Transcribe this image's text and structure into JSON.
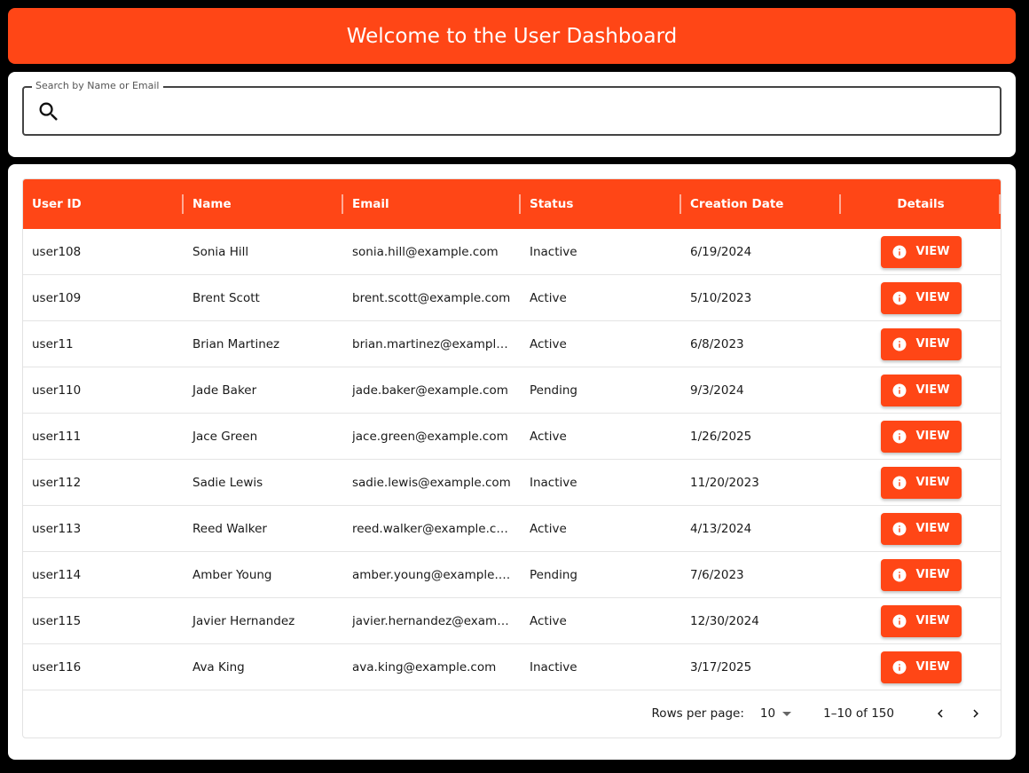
{
  "header": {
    "title": "Welcome to the User Dashboard"
  },
  "search": {
    "label": "Search by Name or Email",
    "value": ""
  },
  "table": {
    "columns": {
      "user_id": "User ID",
      "name": "Name",
      "email": "Email",
      "status": "Status",
      "creation_date": "Creation Date",
      "details": "Details"
    },
    "view_label": "VIEW",
    "rows": [
      {
        "id": "user108",
        "name": "Sonia Hill",
        "email": "sonia.hill@example.com",
        "status": "Inactive",
        "date": "6/19/2024"
      },
      {
        "id": "user109",
        "name": "Brent Scott",
        "email": "brent.scott@example.com",
        "status": "Active",
        "date": "5/10/2023"
      },
      {
        "id": "user11",
        "name": "Brian Martinez",
        "email": "brian.martinez@example.com",
        "status": "Active",
        "date": "6/8/2023"
      },
      {
        "id": "user110",
        "name": "Jade Baker",
        "email": "jade.baker@example.com",
        "status": "Pending",
        "date": "9/3/2024"
      },
      {
        "id": "user111",
        "name": "Jace Green",
        "email": "jace.green@example.com",
        "status": "Active",
        "date": "1/26/2025"
      },
      {
        "id": "user112",
        "name": "Sadie Lewis",
        "email": "sadie.lewis@example.com",
        "status": "Inactive",
        "date": "11/20/2023"
      },
      {
        "id": "user113",
        "name": "Reed Walker",
        "email": "reed.walker@example.com",
        "status": "Active",
        "date": "4/13/2024"
      },
      {
        "id": "user114",
        "name": "Amber Young",
        "email": "amber.young@example.com",
        "status": "Pending",
        "date": "7/6/2023"
      },
      {
        "id": "user115",
        "name": "Javier Hernandez",
        "email": "javier.hernandez@example.com",
        "status": "Active",
        "date": "12/30/2024"
      },
      {
        "id": "user116",
        "name": "Ava King",
        "email": "ava.king@example.com",
        "status": "Inactive",
        "date": "3/17/2025"
      }
    ]
  },
  "pagination": {
    "rows_per_page_label": "Rows per page:",
    "rows_per_page_value": "10",
    "range": "1–10 of 150"
  },
  "colors": {
    "accent": "#FF4616"
  },
  "icons": {
    "search": "search-icon",
    "info": "info-icon",
    "prev": "chevron-left-icon",
    "next": "chevron-right-icon",
    "select": "caret-down-icon"
  }
}
